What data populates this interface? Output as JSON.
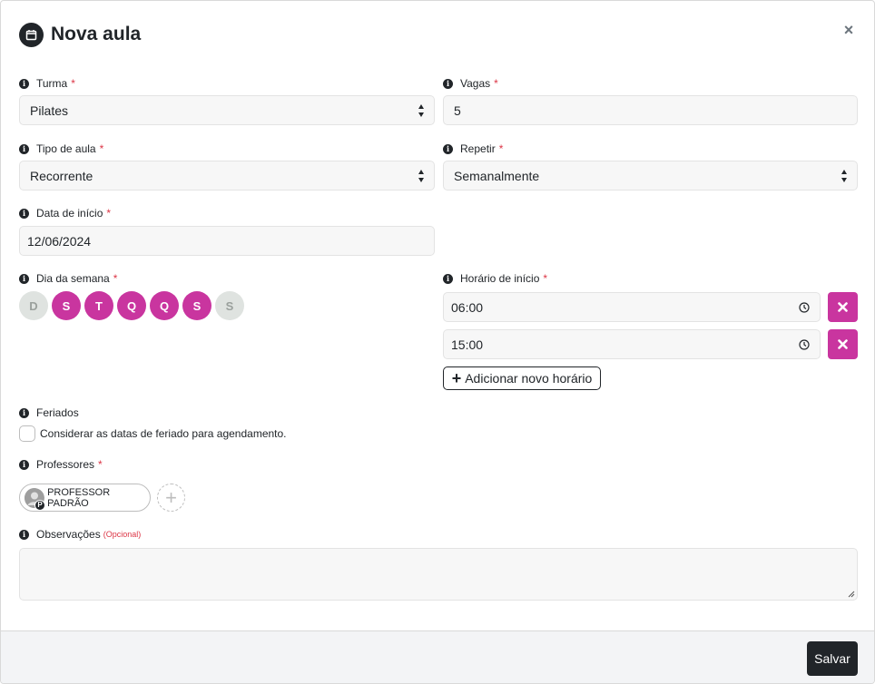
{
  "modal": {
    "title": "Nova aula",
    "close_symbol": "×",
    "title_icon": "calendar-icon",
    "accent_color": "#c9359f"
  },
  "form": {
    "turma": {
      "label": "Turma",
      "required": "*",
      "value": "Pilates"
    },
    "vagas": {
      "label": "Vagas",
      "required": "*",
      "value": "5"
    },
    "tipo_aula": {
      "label": "Tipo de aula",
      "required": "*",
      "value": "Recorrente"
    },
    "repetir": {
      "label": "Repetir",
      "required": "*",
      "value": "Semanalmente"
    },
    "data_inicio": {
      "label": "Data de início",
      "required": "*",
      "value": "12/06/2024"
    },
    "dia_semana": {
      "label": "Dia da semana",
      "required": "*",
      "days": [
        {
          "letter": "D",
          "selected": false
        },
        {
          "letter": "S",
          "selected": true
        },
        {
          "letter": "T",
          "selected": true
        },
        {
          "letter": "Q",
          "selected": true
        },
        {
          "letter": "Q",
          "selected": true
        },
        {
          "letter": "S",
          "selected": true
        },
        {
          "letter": "S",
          "selected": false
        }
      ]
    },
    "horario_inicio": {
      "label": "Horário de início",
      "required": "*",
      "times": [
        "06:00",
        "15:00"
      ],
      "add_label": "Adicionar novo horário"
    },
    "feriados": {
      "label": "Feriados",
      "checkbox_label": "Considerar as datas de feriado para agendamento.",
      "checked": false
    },
    "professores": {
      "label": "Professores",
      "required": "*",
      "items": [
        {
          "name": "PROFESSOR PADRÃO",
          "badge": "P"
        }
      ],
      "add_symbol": "+"
    },
    "observacoes": {
      "label": "Observações",
      "optional": "(Opcional)",
      "value": ""
    }
  },
  "footer": {
    "save_label": "Salvar"
  },
  "info_symbol": "i"
}
